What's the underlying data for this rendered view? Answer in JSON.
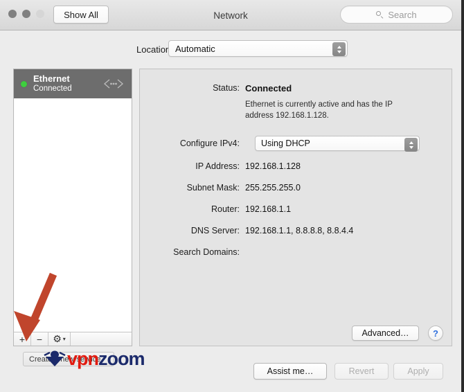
{
  "window": {
    "title": "Network",
    "show_all_label": "Show All",
    "traffic_lights": [
      "close",
      "minimize",
      "zoom"
    ]
  },
  "search": {
    "placeholder": "Search",
    "icon": "search-icon"
  },
  "location": {
    "label": "Location:",
    "value": "Automatic",
    "options": [
      "Automatic"
    ]
  },
  "sidebar": {
    "services": [
      {
        "name": "Ethernet",
        "status": "Connected",
        "status_color": "#3ecf3e",
        "icon": "ethernet-icon",
        "selected": true
      }
    ],
    "toolbar": {
      "add_label": "+",
      "remove_label": "−",
      "gear_label": "⚙",
      "gear_chevron": "▾"
    },
    "tooltip": "Create a new service"
  },
  "detail": {
    "status_label": "Status:",
    "status_value": "Connected",
    "status_description": "Ethernet is currently active and has the IP address 192.168.1.128.",
    "configure_label": "Configure IPv4:",
    "configure_value": "Using DHCP",
    "configure_options": [
      "Using DHCP"
    ],
    "fields": [
      {
        "label": "IP Address:",
        "value": "192.168.1.128"
      },
      {
        "label": "Subnet Mask:",
        "value": "255.255.255.0"
      },
      {
        "label": "Router:",
        "value": "192.168.1.1"
      },
      {
        "label": "DNS Server:",
        "value": "192.168.1.1, 8.8.8.8, 8.8.4.4"
      },
      {
        "label": "Search Domains:",
        "value": ""
      }
    ],
    "advanced_label": "Advanced…",
    "help_label": "?"
  },
  "footer": {
    "assist_label": "Assist me…",
    "revert_label": "Revert",
    "apply_label": "Apply",
    "revert_enabled": false,
    "apply_enabled": false
  },
  "annotation": {
    "arrow_color": "#c0452c",
    "arrow_target": "add-service-button"
  },
  "watermark": {
    "text_primary": "vpn",
    "text_secondary": "zoom",
    "color_primary": "#e11b10",
    "color_secondary": "#1b2a6b"
  }
}
